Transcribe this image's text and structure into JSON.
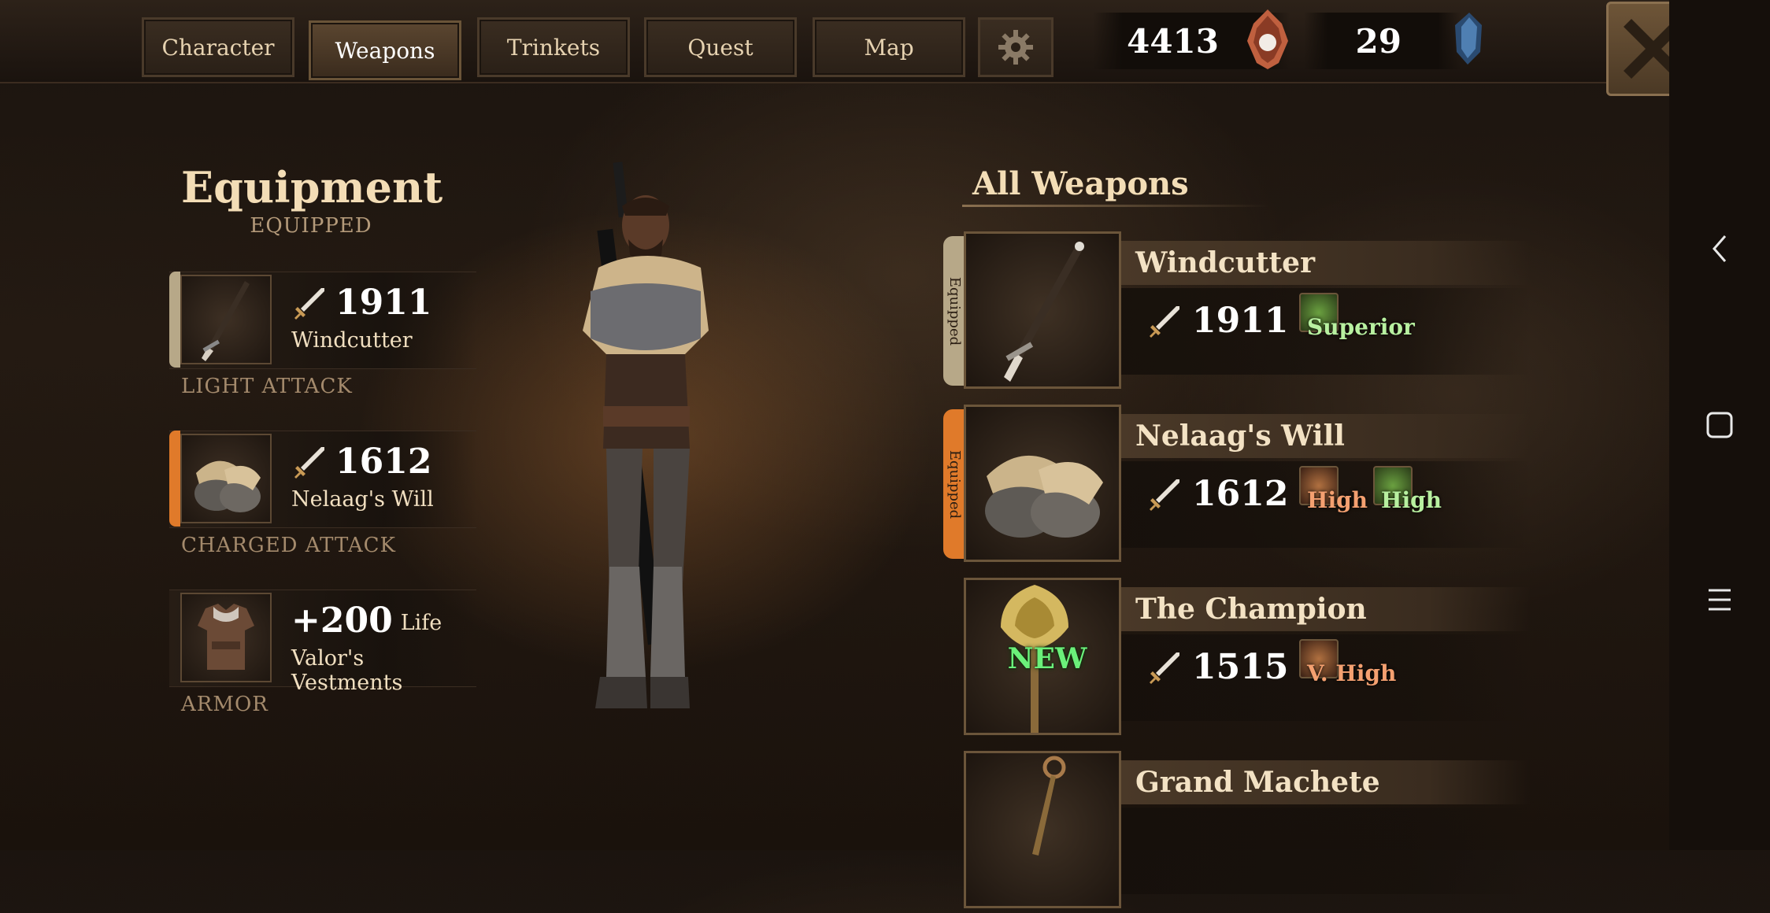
{
  "tabs": [
    {
      "label": "Character",
      "active": false
    },
    {
      "label": "Weapons",
      "active": true
    },
    {
      "label": "Trinkets",
      "active": false
    },
    {
      "label": "Quest",
      "active": false
    },
    {
      "label": "Map",
      "active": false
    }
  ],
  "currencies": [
    {
      "value": "4413",
      "icon": "soul-gem-icon"
    },
    {
      "value": "29",
      "icon": "blue-crystal-icon"
    }
  ],
  "equipment": {
    "title": "Equipment",
    "subtitle": "EQUIPPED",
    "slots": [
      {
        "value": "1911",
        "name": "Windcutter",
        "label": "LIGHT ATTACK",
        "icon": "sword-icon"
      },
      {
        "value": "1612",
        "name": "Nelaag's Will",
        "label": "CHARGED ATTACK",
        "icon": "sword-icon"
      },
      {
        "value": "+200",
        "value_suffix": "Life",
        "name": "Valor's Vestments",
        "label": "ARMOR"
      }
    ]
  },
  "weapons": {
    "title": "All Weapons",
    "equipped_label": "Equipped",
    "new_label": "NEW",
    "items": [
      {
        "name": "Windcutter",
        "power": "1911",
        "equipped": true,
        "perks": [
          {
            "text": "Superior",
            "color": "#b8f0a0"
          }
        ]
      },
      {
        "name": "Nelaag's Will",
        "power": "1612",
        "equipped": true,
        "perks": [
          {
            "text": "High",
            "color": "#f4a070"
          },
          {
            "text": "High",
            "color": "#b8f0a0"
          }
        ]
      },
      {
        "name": "The Champion",
        "power": "1515",
        "equipped": false,
        "new": true,
        "perks": [
          {
            "text": "V. High",
            "color": "#f4a070"
          }
        ]
      },
      {
        "name": "Grand Machete",
        "equipped": false
      }
    ]
  },
  "colors": {
    "equipped_orange": "#e07a2a",
    "equipped_tan": "#b7a888",
    "perk_green": "#b8f0a0",
    "perk_orange": "#f4a070"
  }
}
